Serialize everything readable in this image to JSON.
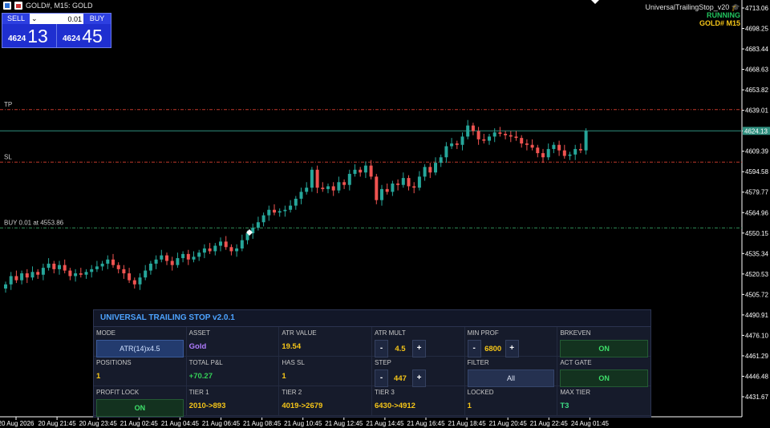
{
  "window": {
    "title": "GOLD#, M15:  GOLD"
  },
  "trade_panel": {
    "sell_label": "SELL",
    "buy_label": "BUY",
    "lot_value": "0.01",
    "sell_small": "4624",
    "sell_big": "13",
    "buy_small": "4624",
    "buy_big": "45"
  },
  "ea": {
    "name": "UniversalTrailingStop_v20",
    "status": "RUNNING",
    "symbol": "GOLD#  M15"
  },
  "chart_data": {
    "type": "candlestick",
    "price_axis": [
      "4713.06",
      "4698.25",
      "4683.44",
      "4668.63",
      "4653.82",
      "4639.01",
      "4624.13",
      "4609.39",
      "4594.58",
      "4579.77",
      "4564.96",
      "4550.15",
      "4535.34",
      "4520.53",
      "4505.72",
      "4490.91",
      "4476.10",
      "4461.29",
      "4446.48",
      "4431.67"
    ],
    "time_axis": [
      "20 Aug 2026",
      "20 Aug 21:45",
      "20 Aug 23:45",
      "21 Aug 02:45",
      "21 Aug 04:45",
      "21 Aug 06:45",
      "21 Aug 08:45",
      "21 Aug 10:45",
      "21 Aug 12:45",
      "21 Aug 14:45",
      "21 Aug 16:45",
      "21 Aug 18:45",
      "21 Aug 20:45",
      "21 Aug 22:45",
      "24 Aug 01:45"
    ],
    "current_price": "4624.13",
    "levels": [
      {
        "label": "TP",
        "price": 4639.5,
        "color": "#c0392b"
      },
      {
        "label": "SL",
        "price": 4601.5,
        "color": "#c0392b"
      },
      {
        "label": "BUY 0.01 at 4553.86",
        "price": 4553.86,
        "color": "#2e8b57"
      }
    ],
    "closes": [
      4513,
      4519,
      4516,
      4521,
      4518,
      4522,
      4520,
      4525,
      4528,
      4524,
      4527,
      4523,
      4519,
      4521,
      4520,
      4522,
      4524,
      4526,
      4528,
      4531,
      4527,
      4524,
      4521,
      4516,
      4513,
      4518,
      4523,
      4528,
      4531,
      4534,
      4530,
      4527,
      4532,
      4535,
      4531,
      4533,
      4536,
      4539,
      4537,
      4541,
      4544,
      4540,
      4537,
      4539,
      4545,
      4550,
      4554,
      4558,
      4563,
      4567,
      4565,
      4566,
      4567,
      4570,
      4575,
      4580,
      4583,
      4596,
      4583,
      4582,
      4584,
      4581,
      4587,
      4585,
      4593,
      4596,
      4594,
      4599,
      4591,
      4574,
      4582,
      4580,
      4586,
      4585,
      4590,
      4584,
      4583,
      4591,
      4598,
      4594,
      4601,
      4605,
      4613,
      4615,
      4614,
      4620,
      4628,
      4624,
      4618,
      4617,
      4620,
      4623,
      4622,
      4621,
      4620,
      4619,
      4615,
      4614,
      4612,
      4608,
      4605,
      4611,
      4614,
      4610,
      4606,
      4607,
      4611,
      4610,
      4624
    ]
  },
  "panel": {
    "title": "UNIVERSAL TRAILING STOP  v2.0.1",
    "cells": [
      {
        "label": "MODE",
        "value": "ATR(14)x4.5"
      },
      {
        "label": "ASSET",
        "value": "Gold"
      },
      {
        "label": "ATR VALUE",
        "value": "19.54"
      },
      {
        "label": "ATR MULT",
        "value": "4.5",
        "minus": "-",
        "plus": "+"
      },
      {
        "label": "MIN PROF",
        "value": "6800",
        "minus": "-",
        "plus": "+"
      },
      {
        "label": "BRKEVEN",
        "value": "ON"
      },
      {
        "label": "POSITIONS",
        "value": "1"
      },
      {
        "label": "TOTAL P&L",
        "value": "+70.27"
      },
      {
        "label": "HAS SL",
        "value": "1"
      },
      {
        "label": "STEP",
        "value": "447",
        "minus": "-",
        "plus": "+"
      },
      {
        "label": "FILTER",
        "value": "All"
      },
      {
        "label": "ACT GATE",
        "value": "ON"
      },
      {
        "label": "PROFIT LOCK",
        "value": "ON"
      },
      {
        "label": "TIER 1",
        "value": "2010->893"
      },
      {
        "label": "TIER 2",
        "value": "4019->2679"
      },
      {
        "label": "TIER 3",
        "value": "6430->4912"
      },
      {
        "label": "LOCKED",
        "value": "1"
      },
      {
        "label": "MAX TIER",
        "value": "T3"
      }
    ]
  }
}
